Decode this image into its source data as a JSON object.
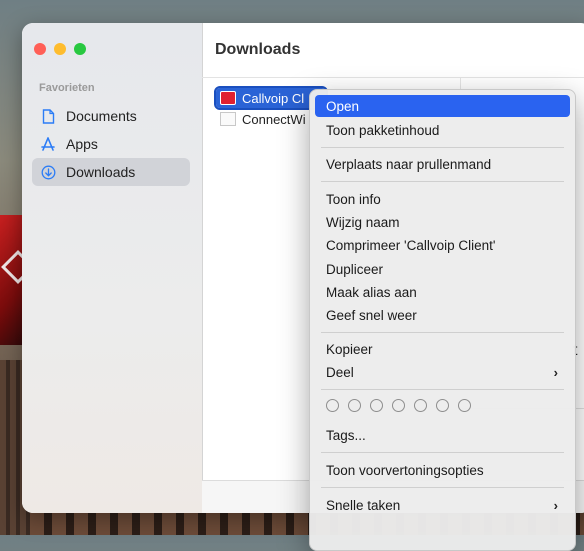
{
  "finder": {
    "title": "Downloads",
    "sidebar": {
      "section_label": "Favorieten",
      "items": [
        {
          "label": "Documents",
          "icon": "document-icon"
        },
        {
          "label": "Apps",
          "icon": "apps-icon"
        },
        {
          "label": "Downloads",
          "icon": "download-icon",
          "selected": true
        }
      ]
    },
    "files": [
      {
        "name": "Callvoip Cl",
        "icon": "app-icon",
        "selected": true
      },
      {
        "name": "ConnectWi",
        "icon": "document-icon"
      }
    ],
    "right_pane_text": "t",
    "right_pane_small": "rc"
  },
  "context_menu": {
    "items": {
      "open": "Open",
      "show_package_contents": "Toon pakketinhoud",
      "move_to_trash": "Verplaats naar prullenmand",
      "get_info": "Toon info",
      "rename": "Wijzig naam",
      "compress": "Comprimeer 'Callvoip Client'",
      "duplicate": "Dupliceer",
      "make_alias": "Maak alias aan",
      "quick_look": "Geef snel weer",
      "copy": "Kopieer",
      "share": "Deel",
      "tags": "Tags...",
      "show_preview_options": "Toon voorvertoningsopties",
      "quick_actions": "Snelle taken"
    },
    "tag_count": 7,
    "highlighted": "open",
    "colors": {
      "highlight": "#2a63f0"
    }
  }
}
